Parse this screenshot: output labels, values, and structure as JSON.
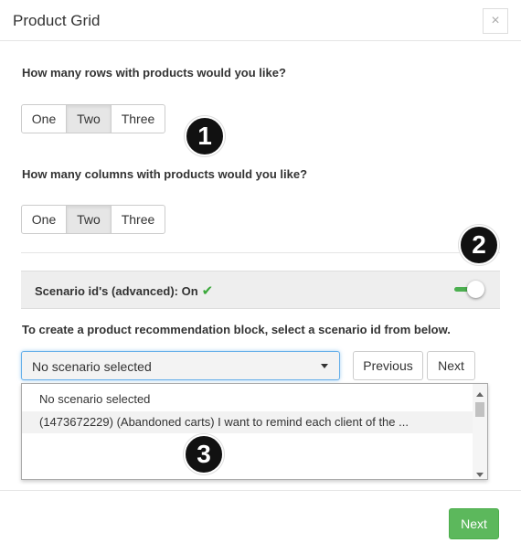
{
  "dialog": {
    "title": "Product Grid",
    "close_symbol": "×"
  },
  "rows": {
    "question": "How many rows with products would you like?",
    "options": [
      "One",
      "Two",
      "Three"
    ],
    "selected": "Two"
  },
  "columns": {
    "question": "How many columns with products would you like?",
    "options": [
      "One",
      "Two",
      "Three"
    ],
    "selected": "Two"
  },
  "badges": [
    "1",
    "2",
    "3"
  ],
  "scenario": {
    "label": "Scenario id's (advanced): On",
    "check_symbol": "✔",
    "toggle_on": true,
    "toggle_color": "#4caf50",
    "instruction": "To create a product recommendation block, select a scenario id from below.",
    "select_value": "No scenario selected",
    "previous_label": "Previous",
    "next_label": "Next",
    "options": [
      "No scenario selected",
      "(1473672229) (Abandoned carts) I want to remind each client of the ..."
    ]
  },
  "footer": {
    "next_label": "Next",
    "next_color": "#5cb85c"
  }
}
